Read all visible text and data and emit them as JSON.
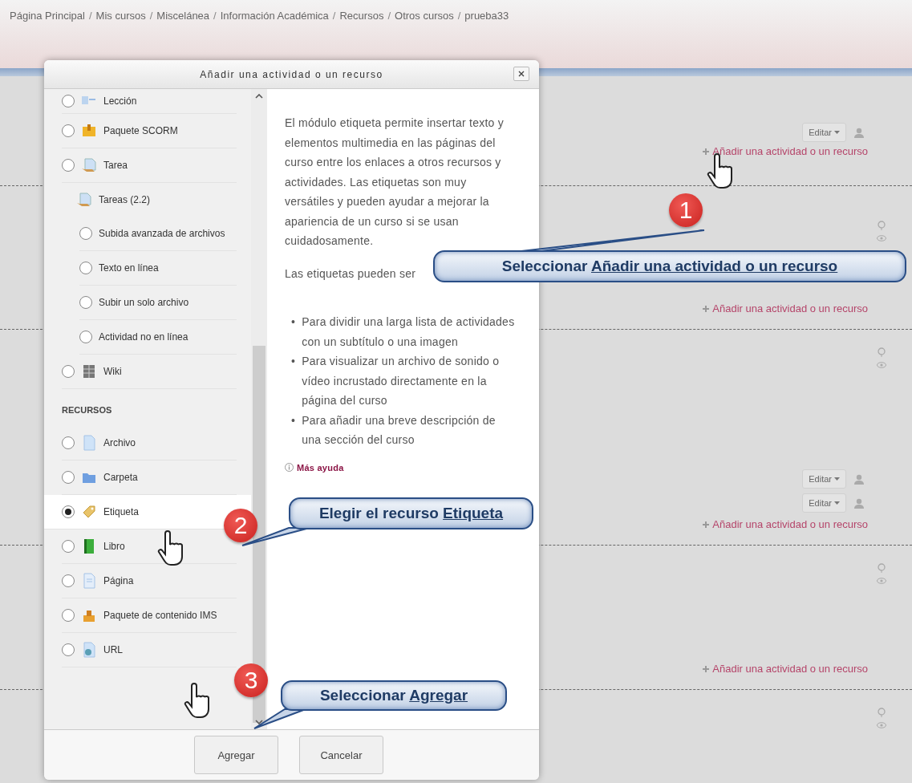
{
  "breadcrumb": {
    "separator": "/",
    "items": [
      "Página Principal",
      "Mis cursos",
      "Miscelánea",
      "Información Académica",
      "Recursos",
      "Otros cursos",
      "prueba33"
    ]
  },
  "course": {
    "sections": [
      {
        "kind": "intro",
        "edit_buttons": [
          "Editar"
        ],
        "add_link": "Añadir una actividad o un recurso"
      },
      {
        "kind": "topic",
        "add_link": "Añadir una actividad o un recurso"
      },
      {
        "kind": "topic",
        "edit_buttons": [
          "Editar",
          "Editar"
        ],
        "add_link": "Añadir una actividad o un recurso"
      },
      {
        "kind": "topic",
        "add_link": "Añadir una actividad o un recurso"
      },
      {
        "kind": "topic"
      }
    ]
  },
  "dialog": {
    "title": "Añadir una actividad o un recurso",
    "options": [
      {
        "kind": "option",
        "label": "Lección",
        "selected": false
      },
      {
        "kind": "option",
        "label": "Paquete SCORM",
        "selected": false
      },
      {
        "kind": "option",
        "label": "Tarea",
        "selected": false
      },
      {
        "kind": "group",
        "label": "Tareas (2.2)",
        "children": [
          {
            "kind": "option",
            "label": "Subida avanzada de archivos",
            "selected": false
          },
          {
            "kind": "option",
            "label": "Texto en línea",
            "selected": false
          },
          {
            "kind": "option",
            "label": "Subir un solo archivo",
            "selected": false
          },
          {
            "kind": "option",
            "label": "Actividad no en línea",
            "selected": false
          }
        ]
      },
      {
        "kind": "option",
        "label": "Wiki",
        "selected": false
      },
      {
        "kind": "heading",
        "label": "RECURSOS"
      },
      {
        "kind": "option",
        "label": "Archivo",
        "selected": false
      },
      {
        "kind": "option",
        "label": "Carpeta",
        "selected": false
      },
      {
        "kind": "option",
        "label": "Etiqueta",
        "selected": true
      },
      {
        "kind": "option",
        "label": "Libro",
        "selected": false
      },
      {
        "kind": "option",
        "label": "Página",
        "selected": false
      },
      {
        "kind": "option",
        "label": "Paquete de contenido IMS",
        "selected": false
      },
      {
        "kind": "option",
        "label": "URL",
        "selected": false
      }
    ],
    "description": {
      "paragraphs": [
        "El módulo etiqueta permite insertar texto y elementos multimedia en las páginas del curso entre los enlaces a otros recursos y actividades. Las etiquetas son muy versátiles y pueden ayudar a mejorar la apariencia de un curso si se usan cuidadosamente.",
        "Las etiquetas pueden ser"
      ],
      "bullet_marker": "•",
      "bullets": [
        "Para dividir una larga lista de actividades con un subtítulo o una imagen",
        "Para visualizar un archivo de sonido o vídeo incrustado directamente en la página del curso",
        "Para añadir una breve descripción de una sección del curso"
      ],
      "help_link": "Más ayuda"
    },
    "buttons": [
      "Agregar",
      "Cancelar"
    ]
  },
  "annotations": [
    {
      "number": "1",
      "text": "Seleccionar",
      "emphasis": "Añadir una actividad o un recurso"
    },
    {
      "number": "2",
      "text": "Elegir el recurso",
      "emphasis": "Etiqueta"
    },
    {
      "number": "3",
      "text": "Seleccionar",
      "emphasis": "Agregar"
    }
  ]
}
